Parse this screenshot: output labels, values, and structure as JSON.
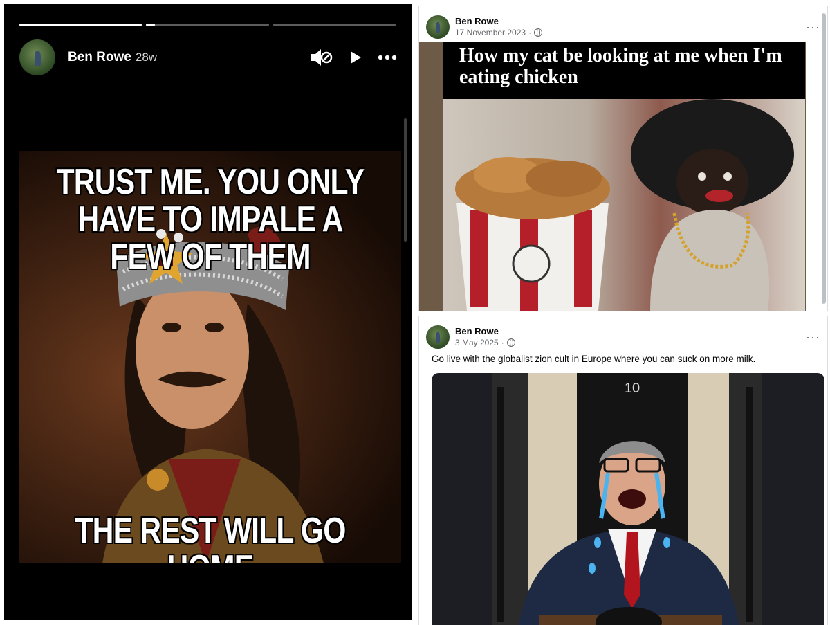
{
  "story": {
    "author": "Ben Rowe",
    "age": "28w",
    "progress": [
      1.0,
      0.07,
      0.0
    ],
    "controls": [
      "mute-icon",
      "play-icon",
      "more-icon"
    ],
    "meme": {
      "top_text": "TRUST ME. YOU ONLY HAVE TO IMPALE A FEW OF THEM",
      "bottom_text": "THE REST WILL GO HOME"
    }
  },
  "post1": {
    "author": "Ben Rowe",
    "date": "17 November 2023",
    "more": "···",
    "meme_caption": "How my cat be looking at me when I'm eating chicken"
  },
  "post2": {
    "author": "Ben Rowe",
    "date": "3 May 2025",
    "more": "···",
    "text": "Go live with the globalist zion cult in Europe where you can suck on more milk.",
    "door_number": "10"
  },
  "colors": {
    "story_bg": "#000000",
    "facebook_text": "#050505",
    "meta_gray": "#65676b"
  }
}
